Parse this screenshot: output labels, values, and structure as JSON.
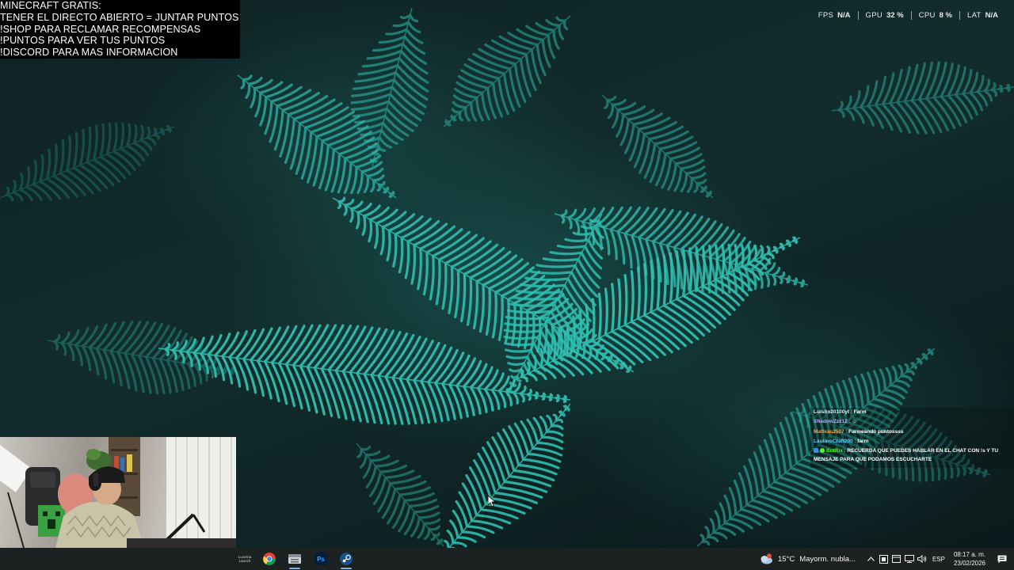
{
  "overlay": {
    "lines": [
      "MINECRAFT GRATIS:",
      "TENER EL DIRECTO ABIERTO = JUNTAR PUNTOS",
      "!SHOP PARA RECLAMAR RECOMPENSAS",
      "!PUNTOS PARA VER TUS PUNTOS",
      "!DISCORD PARA MAS INFORMACION"
    ]
  },
  "stats": [
    {
      "label": "FPS",
      "value": "N/A"
    },
    {
      "label": "GPU",
      "value": "32 %"
    },
    {
      "label": "CPU",
      "value": "8 %"
    },
    {
      "label": "LAT",
      "value": "N/A"
    }
  ],
  "chat": {
    "messages": [
      {
        "user": "Luisito20100yt",
        "sep": " : ",
        "text": "Farm",
        "color": "#dfe6f5"
      },
      {
        "user": "ShadowZzz12",
        "sep": " : ",
        "text": "☺",
        "color": "#c9a3ff"
      },
      {
        "user": "Mathias2507",
        "sep": " : ",
        "text": "Farmeando puntossss",
        "color": "#ff9f40"
      },
      {
        "user": "LautaroCraft200",
        "sep": " : ",
        "text": "farm",
        "color": "#5fd0ff"
      },
      {
        "user": "BotRix",
        "sep": " : ",
        "text": "RECUERDA QUE PUEDES HABLAR EN EL CHAT CON !s Y TU MENSAJE PARA QUE PODAMOS ESCUCHARTE",
        "color": "#53fc18"
      }
    ]
  },
  "taskbar": {
    "apps": [
      {
        "name": "lucerna-app",
        "label": "Lucerna Launch",
        "active": false
      },
      {
        "name": "chrome",
        "label": "",
        "active": false
      },
      {
        "name": "file-explorer",
        "label": "",
        "active": true
      },
      {
        "name": "photoshop",
        "label": "Ps",
        "active": false
      },
      {
        "name": "steam",
        "label": "",
        "active": true
      }
    ],
    "weather": {
      "temp": "15°C",
      "desc": "Mayorm. nubla..."
    },
    "language": "ESP",
    "time": "08:17 a. m.",
    "date": "23/02/2026"
  },
  "colors": {
    "taskbar_bg": "#1c2222",
    "fern": "#2fbfb0",
    "accent_underline": "#7fb0d8",
    "photoshop_blue": "#31a8ff",
    "photoshop_bg": "#001e36"
  }
}
